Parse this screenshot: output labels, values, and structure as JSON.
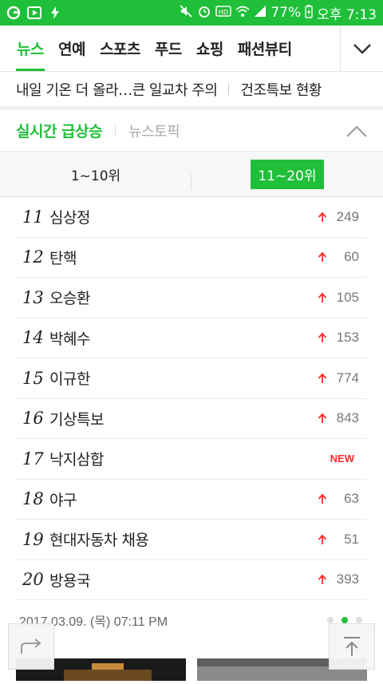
{
  "status_bar": {
    "battery": "77%",
    "time": "오후 7:13"
  },
  "top_tabs": [
    "뉴스",
    "연예",
    "스포츠",
    "푸드",
    "쇼핑",
    "패션뷰티"
  ],
  "ticker": {
    "left": "내일 기온 더 올라…큰 일교차 주의",
    "right": "건조특보 현황"
  },
  "realtime": {
    "title": "실시간 급상승",
    "topic": "뉴스토픽",
    "range_left": "1~10위",
    "range_right": "11~20위"
  },
  "rankings": [
    {
      "rank": "11",
      "keyword": "심상정",
      "count": "249",
      "new": false
    },
    {
      "rank": "12",
      "keyword": "탄핵",
      "count": "60",
      "new": false
    },
    {
      "rank": "13",
      "keyword": "오승환",
      "count": "105",
      "new": false
    },
    {
      "rank": "14",
      "keyword": "박혜수",
      "count": "153",
      "new": false
    },
    {
      "rank": "15",
      "keyword": "이규한",
      "count": "774",
      "new": false
    },
    {
      "rank": "16",
      "keyword": "기상특보",
      "count": "843",
      "new": false
    },
    {
      "rank": "17",
      "keyword": "낙지삼합",
      "count": "NEW",
      "new": true
    },
    {
      "rank": "18",
      "keyword": "야구",
      "count": "63",
      "new": false
    },
    {
      "rank": "19",
      "keyword": "현대자동차 채용",
      "count": "51",
      "new": false
    },
    {
      "rank": "20",
      "keyword": "방용국",
      "count": "393",
      "new": false
    }
  ],
  "timestamp": "2017.03.09. (목) 07:11 PM",
  "colors": {
    "accent": "#1fbf3a",
    "up_arrow": "#ff2a2a",
    "new": "#ff2a2a"
  }
}
